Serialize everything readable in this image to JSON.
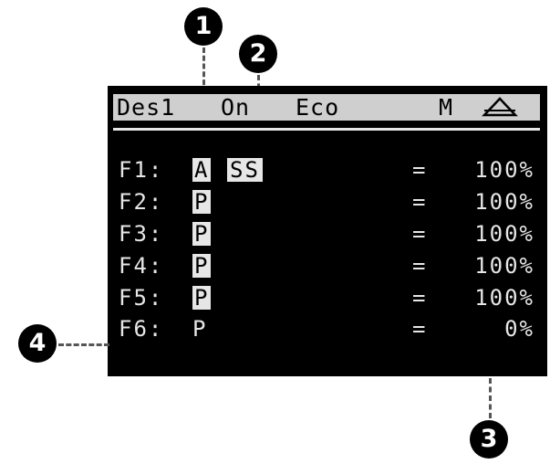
{
  "status_bar": {
    "mode": "Des1",
    "state": "On",
    "eco": "Eco",
    "manual": "M",
    "warning_icon": "warning-triangle-icon"
  },
  "fans": [
    {
      "label": "F1:",
      "code": "A",
      "highlighted": true,
      "extra": "SS",
      "eq": "=",
      "value": "100%"
    },
    {
      "label": "F2:",
      "code": "P",
      "highlighted": true,
      "extra": "",
      "eq": "=",
      "value": "100%"
    },
    {
      "label": "F3:",
      "code": "P",
      "highlighted": true,
      "extra": "",
      "eq": "=",
      "value": "100%"
    },
    {
      "label": "F4:",
      "code": "P",
      "highlighted": true,
      "extra": "",
      "eq": "=",
      "value": "100%"
    },
    {
      "label": "F5:",
      "code": "P",
      "highlighted": true,
      "extra": "",
      "eq": "=",
      "value": "100%"
    },
    {
      "label": "F6:",
      "code": "P",
      "highlighted": false,
      "extra": "",
      "eq": "=",
      "value": "0%"
    }
  ],
  "callouts": [
    "1",
    "2",
    "3",
    "4"
  ],
  "colors": {
    "lcd_background": "#000000",
    "lcd_foreground": "#e6e6e6",
    "status_bar": "#cfcfcf"
  }
}
